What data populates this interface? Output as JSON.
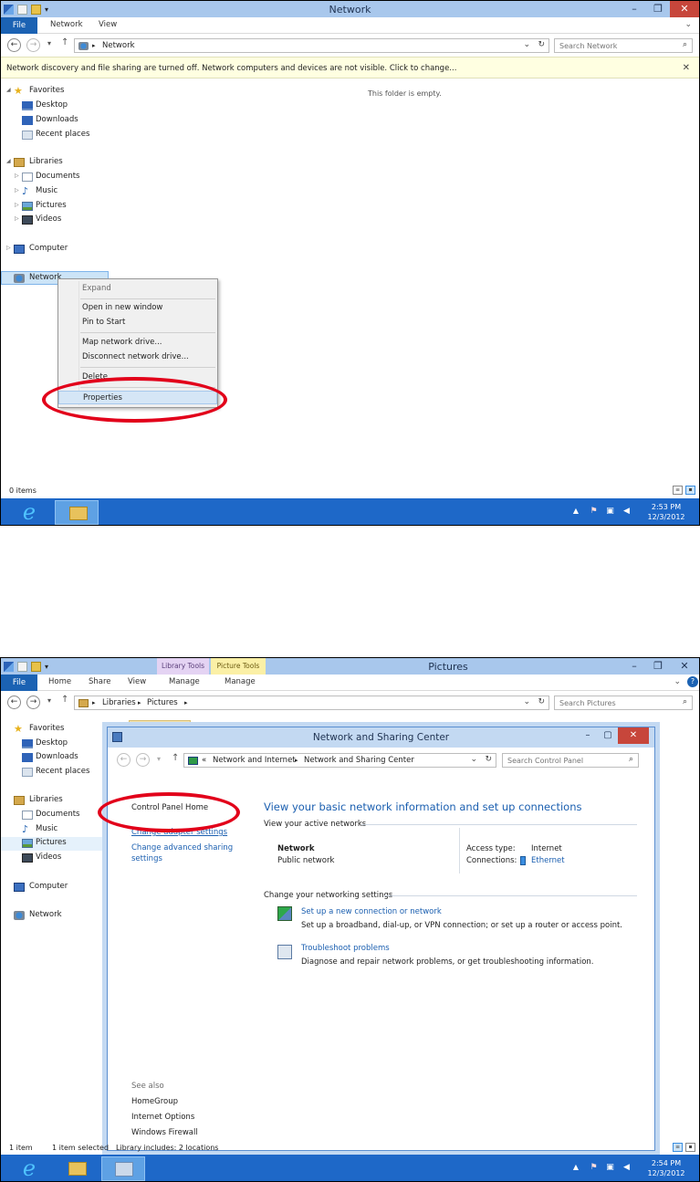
{
  "shot1": {
    "window_title": "Network",
    "ribbon": {
      "file": "File",
      "tabs": [
        "Network",
        "View"
      ]
    },
    "address": {
      "path": "Network",
      "search_placeholder": "Search Network"
    },
    "infobar": {
      "message": "Network discovery and file sharing are turned off. Network computers and devices are not visible. Click to change..."
    },
    "nav": {
      "favorites": "Favorites",
      "desktop": "Desktop",
      "downloads": "Downloads",
      "recent": "Recent places",
      "libraries": "Libraries",
      "documents": "Documents",
      "music": "Music",
      "pictures": "Pictures",
      "videos": "Videos",
      "computer": "Computer",
      "network": "Network"
    },
    "empty_text": "This folder is empty.",
    "context_menu": {
      "expand": "Expand",
      "open_new_window": "Open in new window",
      "pin_to_start": "Pin to Start",
      "map_drive": "Map network drive...",
      "disconnect_drive": "Disconnect network drive...",
      "delete": "Delete",
      "properties": "Properties"
    },
    "status": {
      "items": "0 items"
    },
    "clock": {
      "time": "2:53 PM",
      "date": "12/3/2012"
    }
  },
  "shot2": {
    "window_title": "Pictures",
    "ribbon": {
      "file": "File",
      "tabs": [
        "Home",
        "Share",
        "View",
        "Manage",
        "Manage"
      ],
      "context_groups": [
        "Library Tools",
        "Picture Tools"
      ],
      "context_colors": [
        "#e4d3f3",
        "#fbf0a6"
      ]
    },
    "address": {
      "crumbs": [
        "Libraries",
        "Pictures"
      ],
      "search_placeholder": "Search Pictures"
    },
    "nav": {
      "favorites": "Favorites",
      "desktop": "Desktop",
      "downloads": "Downloads",
      "recent": "Recent places",
      "libraries": "Libraries",
      "documents": "Documents",
      "music": "Music",
      "pictures": "Pictures",
      "videos": "Videos",
      "computer": "Computer",
      "network": "Network"
    },
    "status": {
      "items": "1 item",
      "selected": "1 item selected",
      "library": "Library includes: 2 locations"
    },
    "clock": {
      "time": "2:54 PM",
      "date": "12/3/2012"
    }
  },
  "nsc": {
    "title": "Network and Sharing Center",
    "address": {
      "prefix": "«",
      "crumbs": [
        "Network and Internet",
        "Network and Sharing Center"
      ],
      "search_placeholder": "Search Control Panel"
    },
    "sidebar": {
      "home": "Control Panel Home",
      "adapter": "Change adapter settings",
      "advanced_line1": "Change advanced sharing",
      "advanced_line2": "settings",
      "see_also": "See also",
      "homegroup": "HomeGroup",
      "internet_options": "Internet Options",
      "firewall": "Windows Firewall"
    },
    "main": {
      "heading": "View your basic network information and set up connections",
      "active_label": "View your active networks",
      "network_name": "Network",
      "network_type": "Public network",
      "access_label": "Access type:",
      "access_value": "Internet",
      "connections_label": "Connections:",
      "connections_value": "Ethernet",
      "change_label": "Change your networking settings",
      "setup_link": "Set up a new connection or network",
      "setup_desc": "Set up a broadband, dial-up, or VPN connection; or set up a router or access point.",
      "trouble_link": "Troubleshoot problems",
      "trouble_desc": "Diagnose and repair network problems, or get troubleshooting information."
    }
  },
  "colors": {
    "highlight_ring": "#e2001a",
    "taskbar": "#1e68c8",
    "link": "#1b5fb0"
  }
}
